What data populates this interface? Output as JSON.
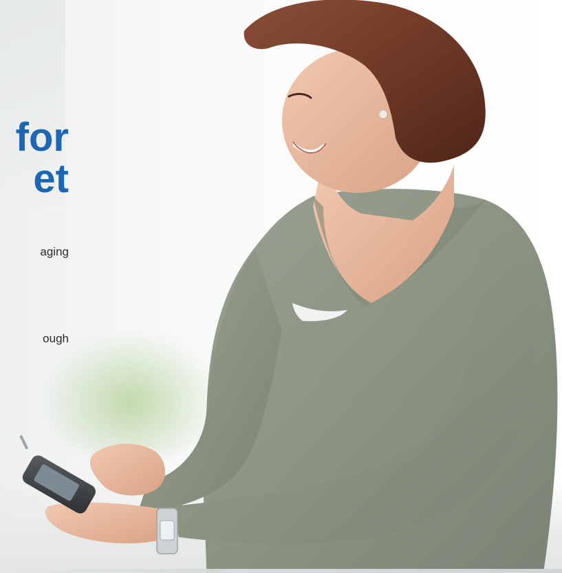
{
  "hero": {
    "headline_line1": "for",
    "headline_line2": "et",
    "body_line1": "aging",
    "body_line2": "ough"
  },
  "colors": {
    "headline": "#1e66b3",
    "body_text": "#2a2a2a",
    "sweater": "#8d9585",
    "hair": "#6e3a28",
    "skin": "#e8b9a0"
  },
  "icons": {
    "device": "handheld-device-icon",
    "watch": "wristwatch-icon"
  }
}
